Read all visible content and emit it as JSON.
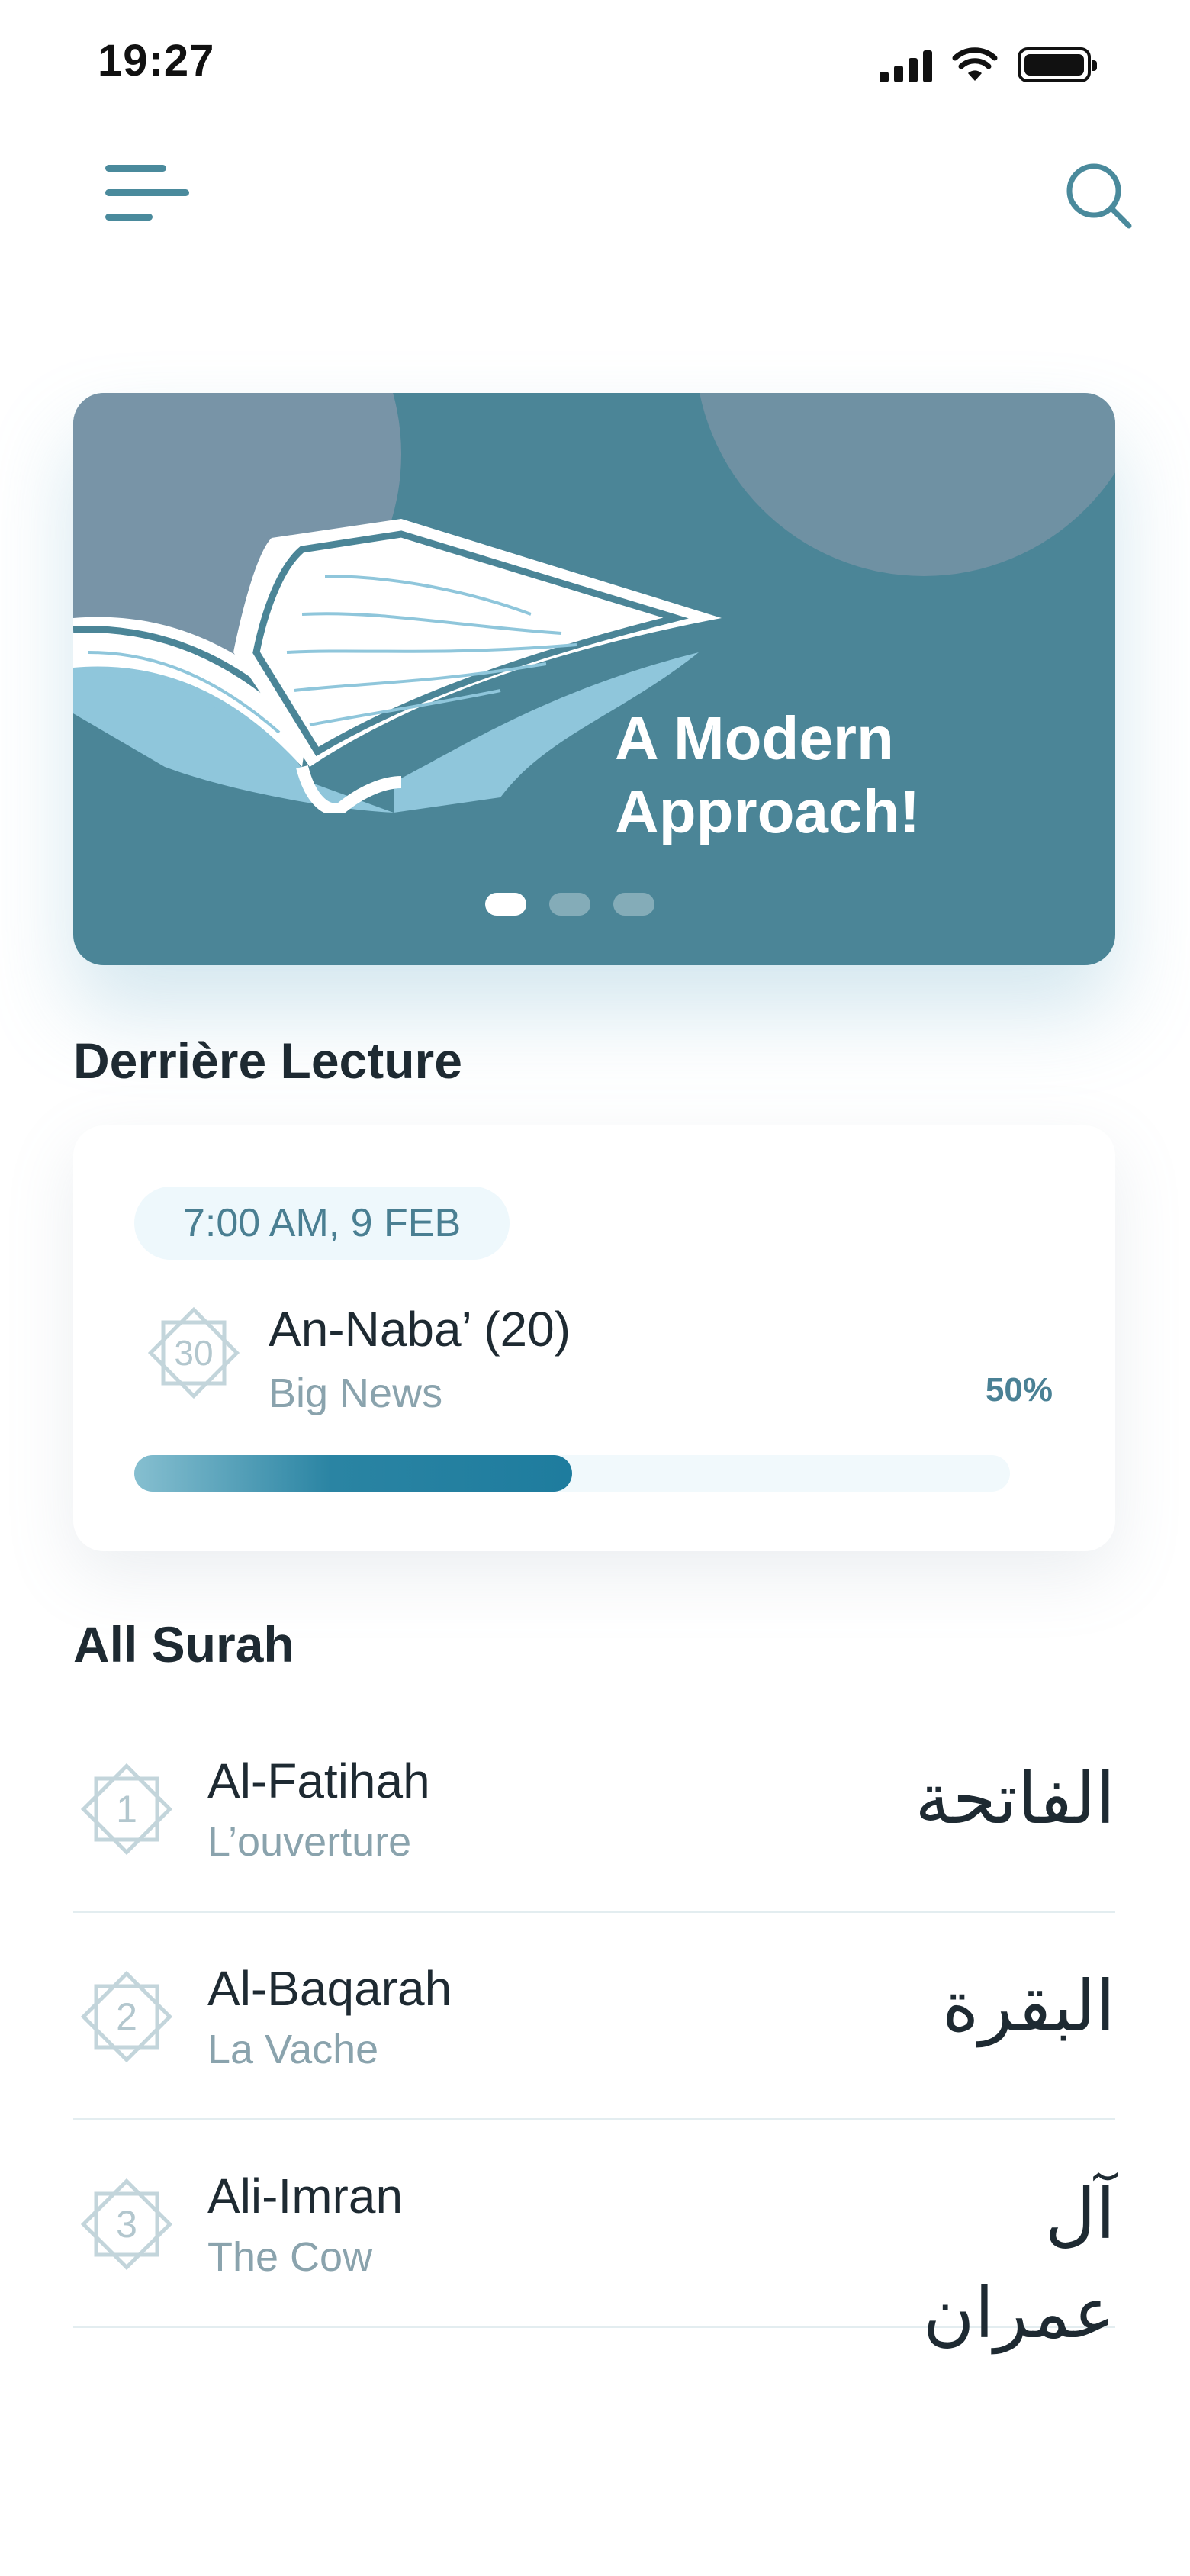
{
  "status_bar": {
    "time": "19:27"
  },
  "banner": {
    "title": "A Modern Approach!",
    "slides": 3,
    "active_slide": 1
  },
  "last_reading": {
    "section_title": "Derrière Lecture",
    "timestamp": "7:00 AM, 9 FEB",
    "badge_number": "30",
    "surah_name": "An-Naba’ (20)",
    "surah_translation": "Big News",
    "progress_label": "50%",
    "progress": 0.5
  },
  "all_surah": {
    "section_title": "All Surah",
    "items": [
      {
        "number": "1",
        "name": "Al-Fatihah",
        "translation": "L’ouverture",
        "arabic": "الفاتحة"
      },
      {
        "number": "2",
        "name": "Al-Baqarah",
        "translation": "La Vache",
        "arabic": "البقرة"
      },
      {
        "number": "3",
        "name": "Ali-Imran",
        "translation": "The Cow",
        "arabic": "آل عمران"
      }
    ]
  },
  "colors": {
    "accent": "#4B8597",
    "progress": "#1E7C9E",
    "muted_text": "#8AA3AD",
    "badge_bg": "#EEF8FC"
  },
  "icons": {
    "menu": "menu-icon",
    "search": "search-icon",
    "signal": "signal-icon",
    "wifi": "wifi-icon",
    "battery": "battery-icon",
    "surah_number": "star-badge-icon"
  }
}
